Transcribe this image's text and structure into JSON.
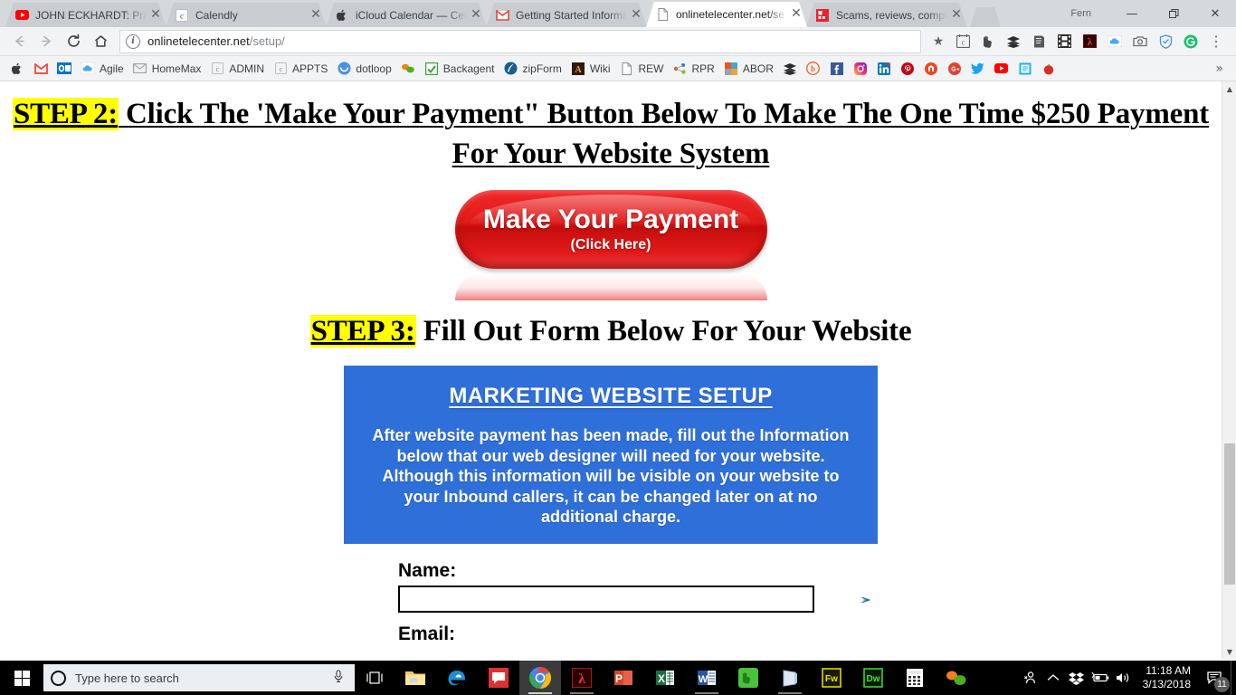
{
  "browser": {
    "profile_name": "Fern",
    "window_controls": {
      "minimize": "—",
      "maximize": "❐",
      "close": "✕"
    },
    "tabs": [
      {
        "title": "JOHN ECKHARDT: Praye",
        "favicon": "youtube-icon",
        "active": false,
        "close": "✕"
      },
      {
        "title": "Calendly",
        "favicon": "calendly-icon",
        "active": false,
        "close": "✕"
      },
      {
        "title": "iCloud Calendar — Cen",
        "favicon": "apple-icon",
        "active": false,
        "close": "✕"
      },
      {
        "title": "Getting Started Informa",
        "favicon": "gmail-icon",
        "active": false,
        "close": "✕"
      },
      {
        "title": "onlinetelecenter.net/se",
        "favicon": "page-icon",
        "active": true,
        "close": "✕"
      },
      {
        "title": "Scams, reviews, compla",
        "favicon": "ripoffreport-icon",
        "active": false,
        "close": "✕"
      }
    ],
    "toolbar": {
      "back": "back-arrow-icon",
      "forward": "forward-arrow-icon",
      "reload": "reload-icon",
      "home": "home-icon",
      "site_info": "i",
      "url_domain": "onlinetelecenter.net",
      "url_path": "/setup/",
      "bookmark_star": "★",
      "extensions": [
        "calendly-extension-icon",
        "evernote-extension-icon",
        "buffer-extension-icon",
        "reader-extension-icon",
        "video-extension-icon",
        "adobe-acrobat-extension-icon",
        "icloud-extension-icon",
        "screenshot-extension-icon",
        "shield-extension-icon",
        "grammarly-extension-icon"
      ],
      "menu": "⋮"
    },
    "bookmarks": [
      {
        "label": "",
        "icon": "apple-icon"
      },
      {
        "label": "",
        "icon": "gmail-icon"
      },
      {
        "label": "",
        "icon": "outlook-icon"
      },
      {
        "label": "Agile",
        "icon": "cloud-icon"
      },
      {
        "label": "HomeMax",
        "icon": "mail-icon"
      },
      {
        "label": "ADMIN",
        "icon": "calendly-icon"
      },
      {
        "label": "APPTS",
        "icon": "calendly-icon"
      },
      {
        "label": "dotloop",
        "icon": "dotloop-icon"
      },
      {
        "label": "",
        "icon": "greenpills-icon"
      },
      {
        "label": "Backagent",
        "icon": "checkbox-icon"
      },
      {
        "label": "zipForm",
        "icon": "zipform-icon"
      },
      {
        "label": "Wiki",
        "icon": "wiki-icon"
      },
      {
        "label": "REW",
        "icon": "page-icon"
      },
      {
        "label": "RPR",
        "icon": "rpr-icon"
      },
      {
        "label": "ABOR",
        "icon": "abor-icon"
      },
      {
        "label": "",
        "icon": "buffer-icon"
      },
      {
        "label": "",
        "icon": "bitly-icon"
      },
      {
        "label": "",
        "icon": "facebook-icon"
      },
      {
        "label": "",
        "icon": "instagram-icon"
      },
      {
        "label": "",
        "icon": "linkedin-icon"
      },
      {
        "label": "",
        "icon": "pinterest-icon"
      },
      {
        "label": "",
        "icon": "stumbleupon-icon"
      },
      {
        "label": "",
        "icon": "googleplus-icon"
      },
      {
        "label": "",
        "icon": "twitter-icon"
      },
      {
        "label": "",
        "icon": "youtube-icon"
      },
      {
        "label": "",
        "icon": "evernote-note-icon"
      },
      {
        "label": "",
        "icon": "tomato-icon"
      }
    ],
    "bookmarks_overflow": "»"
  },
  "page": {
    "step2": {
      "badge": "STEP 2:",
      "text": " Click The 'Make Your Payment\" Button Below To Make The One Time $250 Payment For Your Website System"
    },
    "pay_button": {
      "main_label": "Make Your Payment",
      "sub_label": "(Click Here)",
      "color": "#e01818"
    },
    "step3": {
      "badge": "STEP 3:",
      "text": "Fill Out Form Below For Your Website"
    },
    "blue_box": {
      "bg_color": "#2f6fd9",
      "title": "MARKETING WEBSITE SETUP",
      "body": "After website payment has been made, fill out the Information below that our web designer will need for your website.  Although this information will be visible on your website to your Inbound callers, it can be changed later on at no additional charge."
    },
    "form": {
      "name_label": "Name:",
      "name_value": "",
      "name_placeholder": "",
      "email_label": "Email:"
    },
    "scrollbar": {
      "up_arrow": "▲",
      "down_arrow": "▼"
    }
  },
  "taskbar": {
    "start": "windows-start-icon",
    "search_placeholder": "Type here to search",
    "mic": "microphone-icon",
    "task_view": "task-view-icon",
    "apps": [
      {
        "name": "file-explorer-icon",
        "running": false
      },
      {
        "name": "microsoft-edge-icon",
        "running": false
      },
      {
        "name": "messaging-icon",
        "running": false
      },
      {
        "name": "google-chrome-icon",
        "running": true,
        "active": true
      },
      {
        "name": "adobe-acrobat-icon",
        "running": true
      },
      {
        "name": "powerpoint-icon",
        "running": false
      },
      {
        "name": "excel-icon",
        "running": false
      },
      {
        "name": "word-icon",
        "running": true
      },
      {
        "name": "evernote-icon",
        "running": false
      },
      {
        "name": "sticky-notes-icon",
        "running": true
      },
      {
        "name": "fireworks-icon",
        "running": false
      },
      {
        "name": "dreamweaver-icon",
        "running": false
      },
      {
        "name": "calculator-icon",
        "running": false
      },
      {
        "name": "pills-icon",
        "running": false
      }
    ],
    "tray": [
      "people-icon",
      "show-hidden-icons-icon",
      "dropbox-icon",
      "battery-icon",
      "volume-icon"
    ],
    "clock_time": "11:18 AM",
    "clock_date": "3/13/2018",
    "notification_count": "11"
  }
}
